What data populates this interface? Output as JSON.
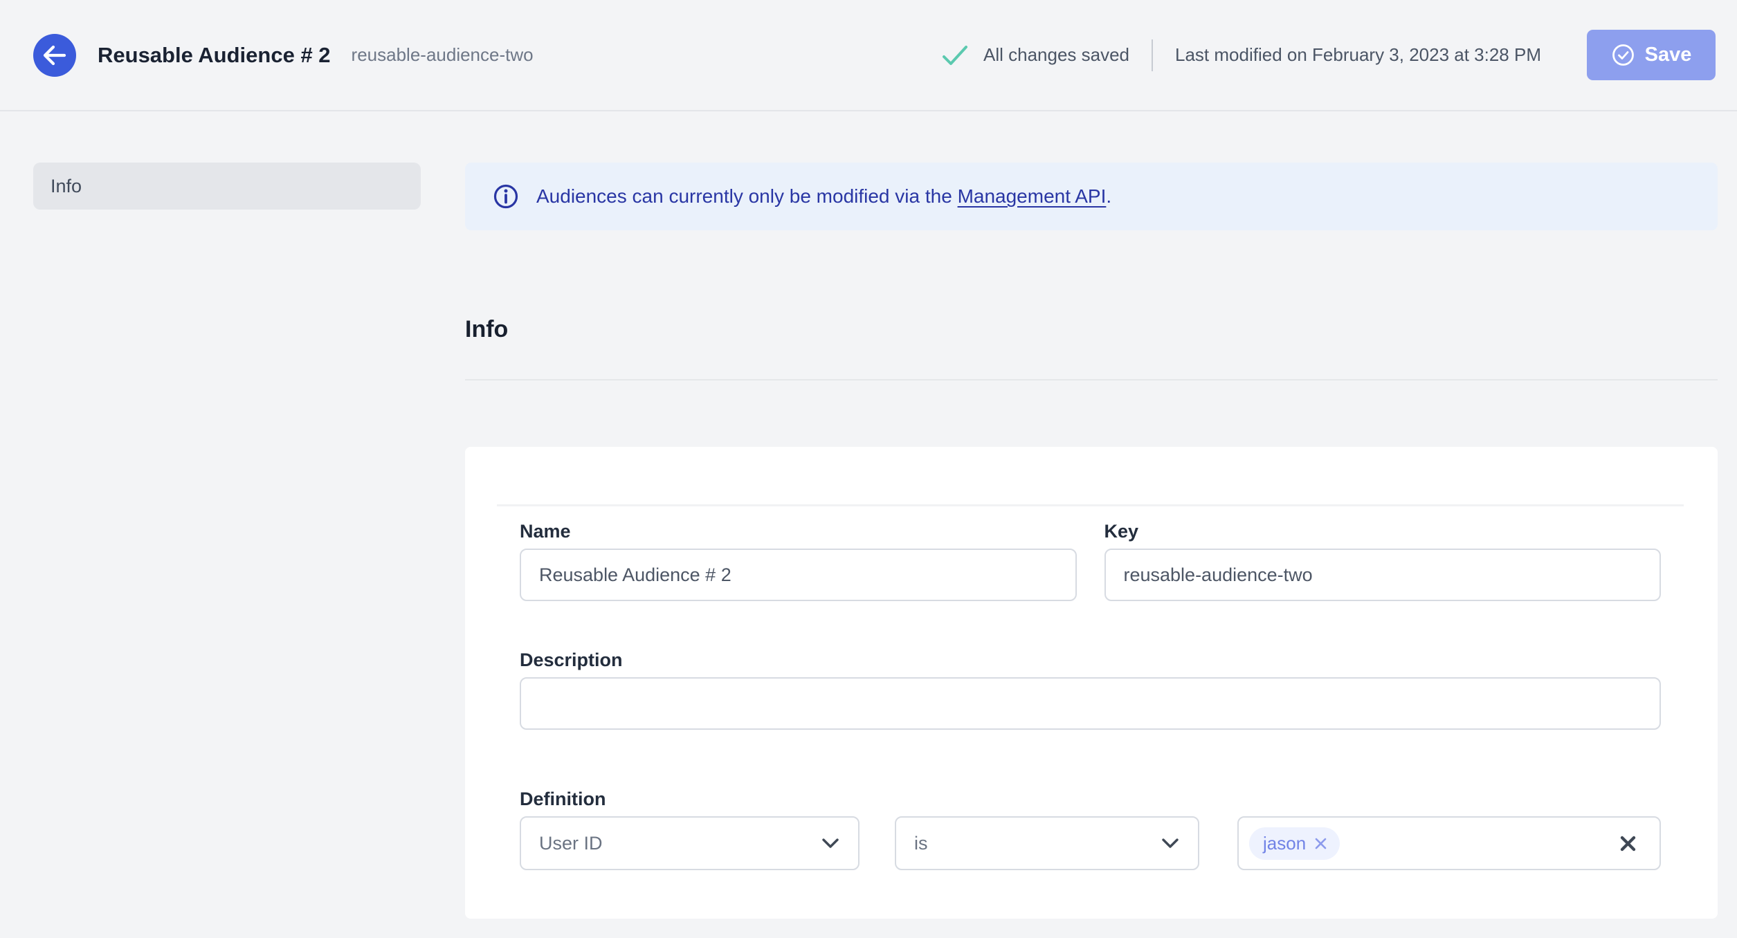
{
  "header": {
    "title": "Reusable Audience # 2",
    "subtitle": "reusable-audience-two",
    "status_text": "All changes saved",
    "last_modified": "Last modified on February 3, 2023 at 3:28 PM",
    "save_label": "Save"
  },
  "sidebar": {
    "items": [
      {
        "label": "Info",
        "active": true
      }
    ]
  },
  "banner": {
    "text_before_link": "Audiences can currently only be modified via the ",
    "link_text": "Management API",
    "text_after_link": "."
  },
  "section": {
    "title": "Info"
  },
  "form": {
    "name": {
      "label": "Name",
      "value": "Reusable Audience # 2"
    },
    "key": {
      "label": "Key",
      "value": "reusable-audience-two"
    },
    "description": {
      "label": "Description",
      "value": ""
    },
    "definition": {
      "label": "Definition",
      "attribute_value": "User ID",
      "operator_value": "is",
      "values": [
        "jason"
      ]
    }
  },
  "icons": {
    "back": "arrow-left-icon",
    "saved": "check-icon",
    "save": "circle-check-icon",
    "banner": "info-circle-icon",
    "select": "chevron-down-icon",
    "tag_remove": "x-icon",
    "clear": "x-icon"
  },
  "colors": {
    "page_bg": "#F3F4F6",
    "accent_blue": "#3B5BDB",
    "save_disabled_bg": "#8D9FEE",
    "success_green": "#5BC9AF",
    "banner_bg": "#EAF1FB",
    "banner_text": "#2936A4",
    "tag_bg": "#EEF2FE",
    "tag_text": "#7183E6",
    "input_border": "#D7DBE2",
    "card_bg": "#FFFFFF"
  }
}
